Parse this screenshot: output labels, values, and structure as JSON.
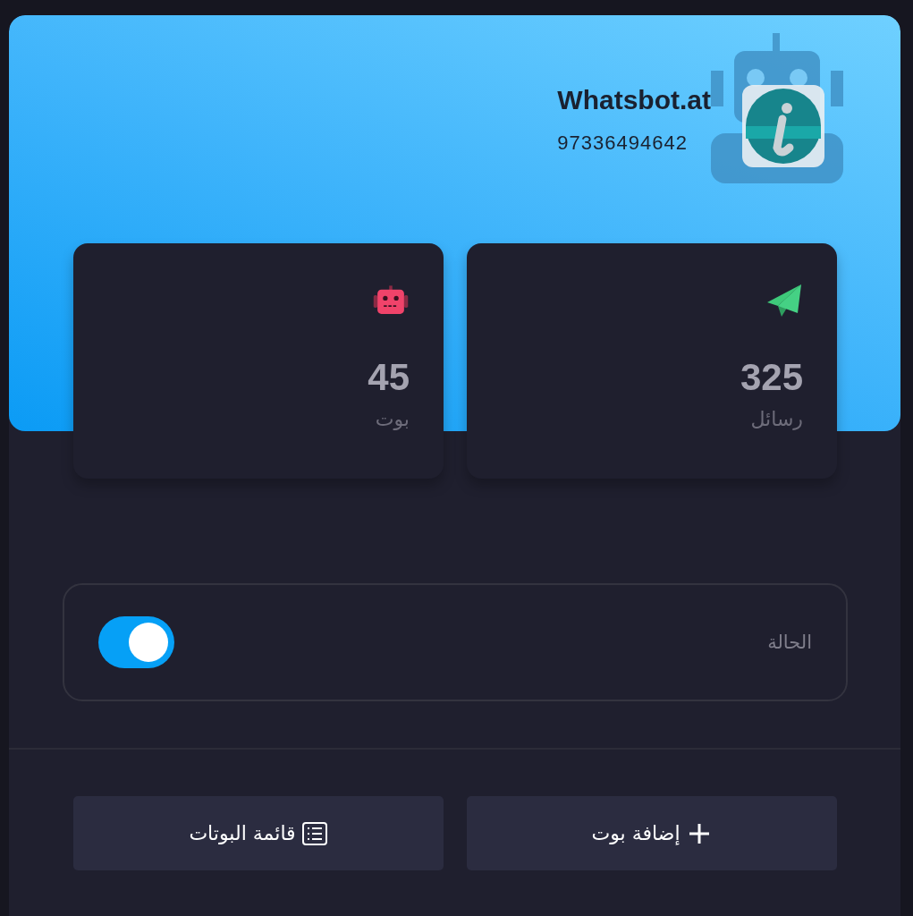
{
  "profile": {
    "name": "Whatsbot.at",
    "phone": "97336494642"
  },
  "stats": [
    {
      "kind": "messages",
      "value": "325",
      "label": "رسائل"
    },
    {
      "kind": "bots",
      "value": "45",
      "label": "بوت"
    }
  ],
  "status": {
    "label": "الحالة",
    "on": true
  },
  "buttons": [
    {
      "kind": "add",
      "label": "إضافة بوت"
    },
    {
      "kind": "list",
      "label": "قائمة البوتات"
    }
  ]
}
